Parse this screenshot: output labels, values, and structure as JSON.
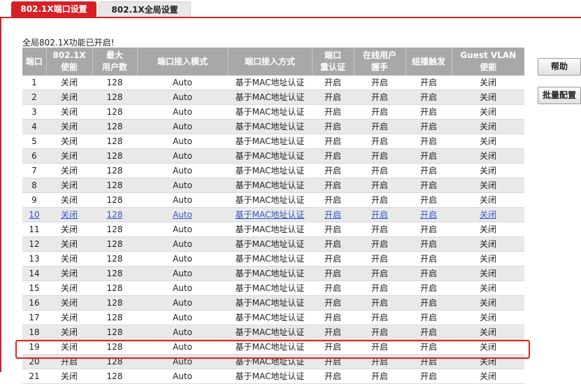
{
  "tabs": [
    {
      "label": "802.1X端口设置",
      "active": true
    },
    {
      "label": "802.1X全局设置",
      "active": false
    }
  ],
  "status_text": "全局802.1X功能已开启!",
  "table": {
    "headers": [
      "端口",
      "802.1X\n使能",
      "最大\n用户数",
      "端口接入模式",
      "端口接入方式",
      "端口\n重认证",
      "在线用户\n握手",
      "组播触发",
      "Guest VLAN\n使能"
    ],
    "rows": [
      [
        "1",
        "关闭",
        "128",
        "Auto",
        "基于MAC地址认证",
        "开启",
        "开启",
        "开启",
        "关闭"
      ],
      [
        "2",
        "关闭",
        "128",
        "Auto",
        "基于MAC地址认证",
        "开启",
        "开启",
        "开启",
        "关闭"
      ],
      [
        "3",
        "关闭",
        "128",
        "Auto",
        "基于MAC地址认证",
        "开启",
        "开启",
        "开启",
        "关闭"
      ],
      [
        "4",
        "关闭",
        "128",
        "Auto",
        "基于MAC地址认证",
        "开启",
        "开启",
        "开启",
        "关闭"
      ],
      [
        "5",
        "关闭",
        "128",
        "Auto",
        "基于MAC地址认证",
        "开启",
        "开启",
        "开启",
        "关闭"
      ],
      [
        "6",
        "关闭",
        "128",
        "Auto",
        "基于MAC地址认证",
        "开启",
        "开启",
        "开启",
        "关闭"
      ],
      [
        "7",
        "关闭",
        "128",
        "Auto",
        "基于MAC地址认证",
        "开启",
        "开启",
        "开启",
        "关闭"
      ],
      [
        "8",
        "关闭",
        "128",
        "Auto",
        "基于MAC地址认证",
        "开启",
        "开启",
        "开启",
        "关闭"
      ],
      [
        "9",
        "关闭",
        "128",
        "Auto",
        "基于MAC地址认证",
        "开启",
        "开启",
        "开启",
        "关闭"
      ],
      [
        "10",
        "关闭",
        "128",
        "Auto",
        "基于MAC地址认证",
        "开启",
        "开启",
        "开启",
        "关闭"
      ],
      [
        "11",
        "关闭",
        "128",
        "Auto",
        "基于MAC地址认证",
        "开启",
        "开启",
        "开启",
        "关闭"
      ],
      [
        "12",
        "关闭",
        "128",
        "Auto",
        "基于MAC地址认证",
        "开启",
        "开启",
        "开启",
        "关闭"
      ],
      [
        "13",
        "关闭",
        "128",
        "Auto",
        "基于MAC地址认证",
        "开启",
        "开启",
        "开启",
        "关闭"
      ],
      [
        "14",
        "关闭",
        "128",
        "Auto",
        "基于MAC地址认证",
        "开启",
        "开启",
        "开启",
        "关闭"
      ],
      [
        "15",
        "关闭",
        "128",
        "Auto",
        "基于MAC地址认证",
        "开启",
        "开启",
        "开启",
        "关闭"
      ],
      [
        "16",
        "关闭",
        "128",
        "Auto",
        "基于MAC地址认证",
        "开启",
        "开启",
        "开启",
        "关闭"
      ],
      [
        "17",
        "关闭",
        "128",
        "Auto",
        "基于MAC地址认证",
        "开启",
        "开启",
        "开启",
        "关闭"
      ],
      [
        "18",
        "关闭",
        "128",
        "Auto",
        "基于MAC地址认证",
        "开启",
        "开启",
        "开启",
        "关闭"
      ],
      [
        "19",
        "关闭",
        "128",
        "Auto",
        "基于MAC地址认证",
        "开启",
        "开启",
        "开启",
        "关闭"
      ],
      [
        "20",
        "开启",
        "128",
        "Auto",
        "基于MAC地址认证",
        "开启",
        "开启",
        "开启",
        "关闭"
      ],
      [
        "21",
        "关闭",
        "128",
        "Auto",
        "基于MAC地址认证",
        "开启",
        "开启",
        "开启",
        "关闭"
      ]
    ],
    "link_row": "10",
    "highlighted_row": "20"
  },
  "buttons": {
    "help": "帮助",
    "batch": "批量配置"
  },
  "colors": {
    "accent": "#d71f26",
    "header_bg": "#a8a8a8",
    "link": "#3358c8",
    "highlight_border": "#e0241a"
  }
}
